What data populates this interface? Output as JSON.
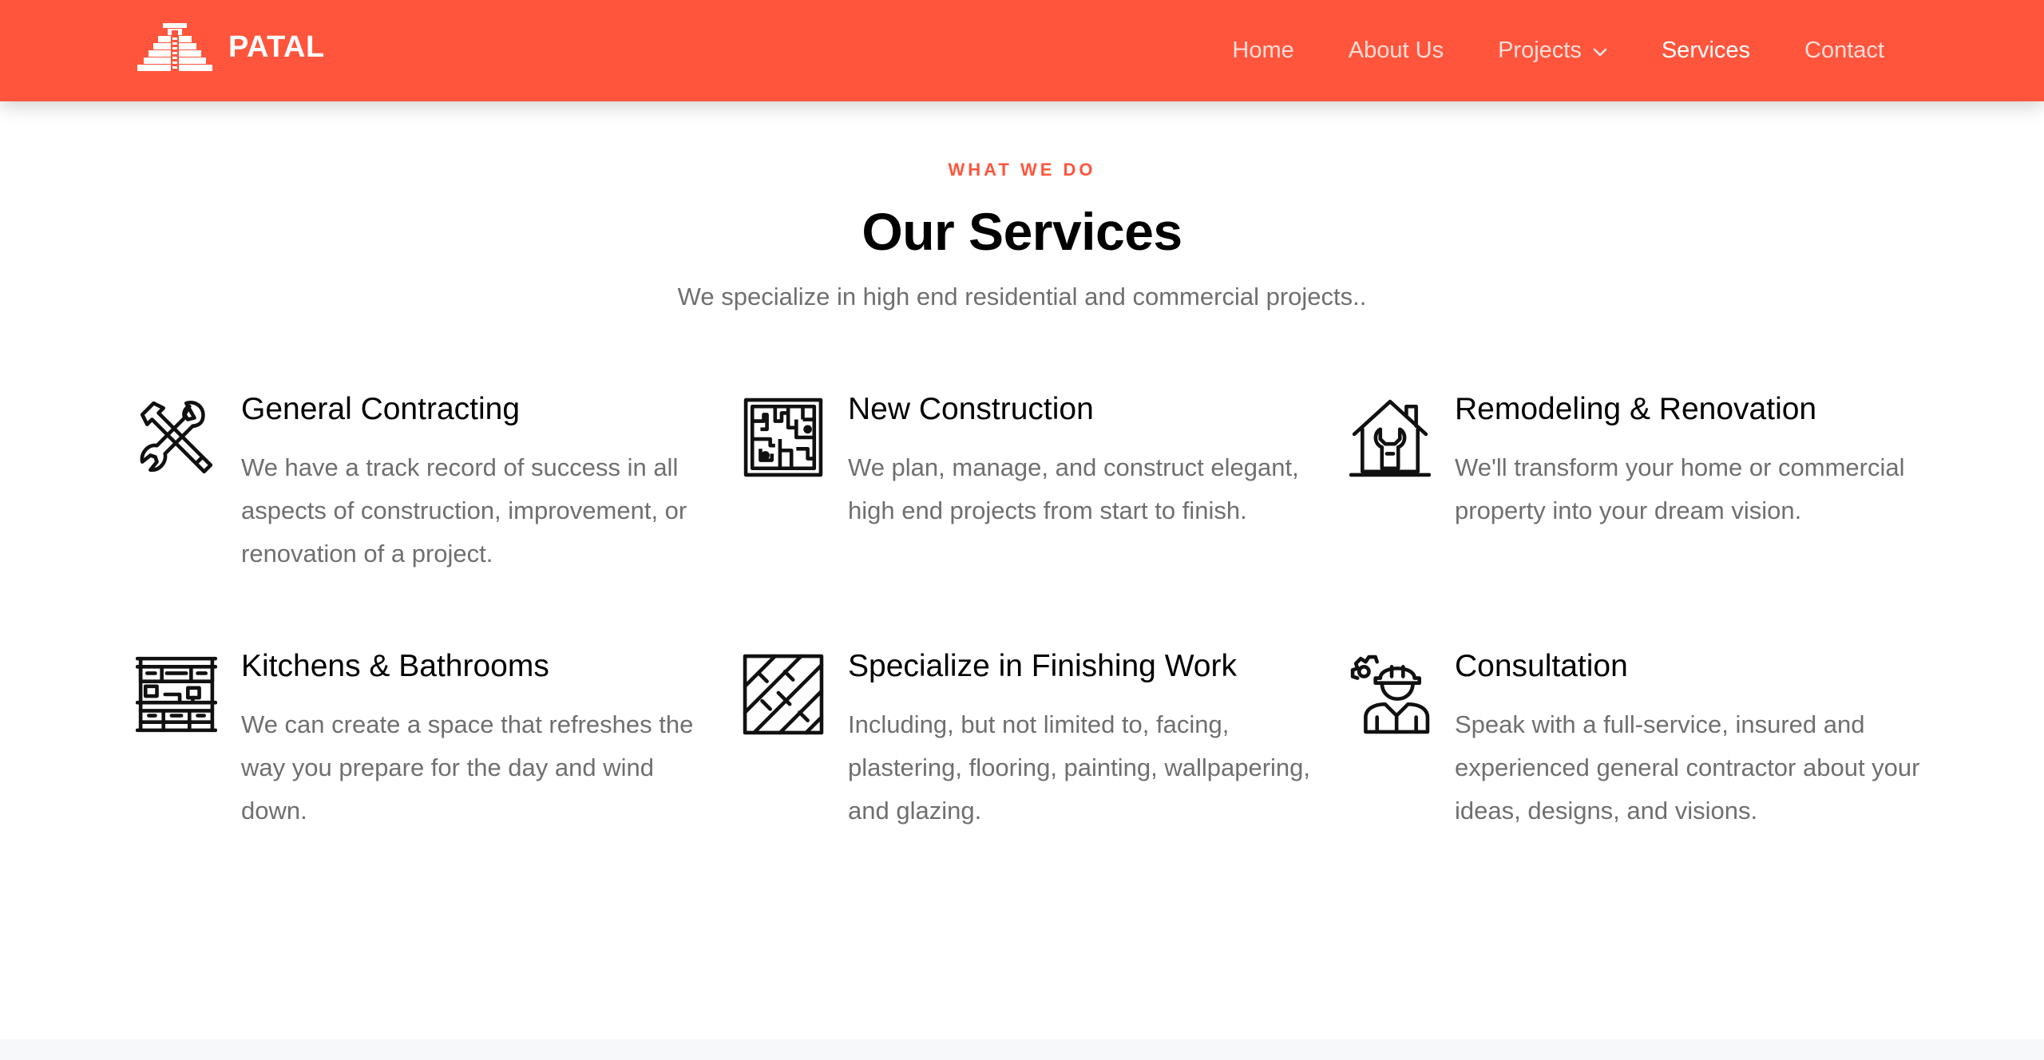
{
  "brand": {
    "name": "PATAL",
    "logo_icon": "pyramid-logo-icon"
  },
  "nav": {
    "items": [
      {
        "label": "Home",
        "active": false
      },
      {
        "label": "About Us",
        "active": false
      },
      {
        "label": "Projects",
        "active": false,
        "has_dropdown": true
      },
      {
        "label": "Services",
        "active": true
      },
      {
        "label": "Contact",
        "active": false
      }
    ]
  },
  "colors": {
    "accent": "#ff553c",
    "heading": "#000000",
    "body_text": "#6f6f6f",
    "nav_text_active": "#ffffff"
  },
  "section": {
    "eyebrow": "WHAT WE DO",
    "title": "Our Services",
    "subtitle": "We specialize in high end residential and commercial projects.."
  },
  "services": [
    {
      "icon": "tools-icon",
      "title": "General Contracting",
      "description": "We have a track record of success in all aspects of construction, improvement, or renovation of a project."
    },
    {
      "icon": "blueprint-icon",
      "title": "New Construction",
      "description": "We plan, manage, and construct elegant, high end projects from start to finish."
    },
    {
      "icon": "house-wrench-icon",
      "title": "Remodeling & Renovation",
      "description": "We'll transform your home or commercial property into your dream vision."
    },
    {
      "icon": "kitchen-icon",
      "title": "Kitchens & Bathrooms",
      "description": "We can create a space that refreshes the way you prepare for the day and wind down."
    },
    {
      "icon": "flooring-icon",
      "title": "Specialize in Finishing Work",
      "description": "Including, but not limited to, facing, plastering, flooring, painting, wallpapering, and glazing."
    },
    {
      "icon": "engineer-icon",
      "title": "Consultation",
      "description": "Speak with a full-service, insured and experienced general contractor about your ideas, designs, and visions."
    }
  ]
}
